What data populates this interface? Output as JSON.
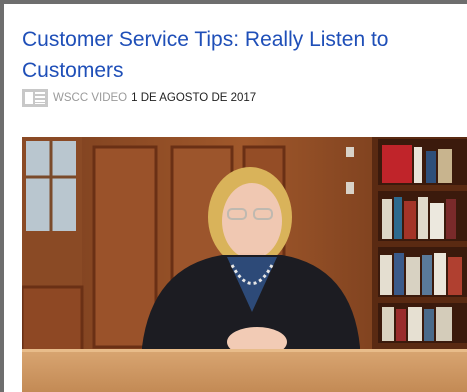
{
  "post": {
    "title": "Customer Service Tips: Really Listen to Customers",
    "category": "WSCC VIDEO",
    "date": "1 DE AGOSTO DE 2017",
    "category_icon": "video-list-icon"
  },
  "video": {
    "thumbnail": "video-thumbnail"
  },
  "colors": {
    "title": "#1f4fb8",
    "category": "#9a9a9a",
    "frame": "#6e6e6e"
  }
}
